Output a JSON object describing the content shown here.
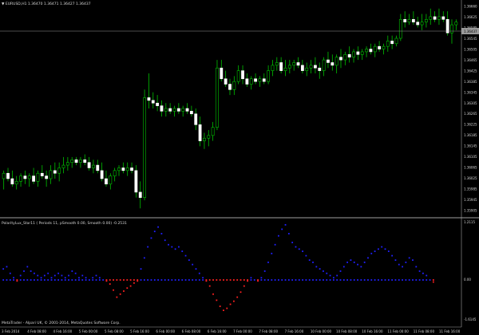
{
  "window": {
    "symbol_header": "▼ EURUSD,H1  1.36470 1.36471 1.36427 1.36437"
  },
  "colors": {
    "background": "#000000",
    "bull_candle": "#ffffff",
    "bear_candle": "#ffffff",
    "wick": "#00c000",
    "grid_separator": "#808080",
    "ask_line": "#9a9a9a",
    "dot_positive": "#2020ff",
    "dot_negative": "#ff2020"
  },
  "indicator": {
    "header": "PolarityLux_Star11  ( Periods 11, pSmooth 0.00, Smooth 0.00)  -0.2531",
    "axis_labels": [
      "1.2115",
      "0.00",
      "-1.6145"
    ]
  },
  "footer": {
    "copyright": "MetaTrader - Alpari UK, © 2001-2014, MetaQuotes Software Corp."
  },
  "price_axis": {
    "labels": [
      "1.36660",
      "1.36625",
      "1.36585",
      "1.36545",
      "1.36505",
      "1.36465",
      "1.36425",
      "1.36385",
      "1.36345",
      "1.36305",
      "1.36265",
      "1.36225",
      "1.36185",
      "1.36145",
      "1.36105",
      "1.36065",
      "1.36025",
      "1.35985",
      "1.35945",
      "1.35905"
    ],
    "ask_label": "1.36437"
  },
  "time_axis": {
    "labels": [
      "3 Feb 2014",
      "4 Feb 08:00",
      "4 Feb 16:00",
      "5 Feb 00:00",
      "5 Feb 08:00",
      "5 Feb 16:00",
      "6 Feb 00:00",
      "6 Feb 08:00",
      "6 Feb 16:00",
      "7 Feb 00:00",
      "7 Feb 08:00",
      "7 Feb 16:00",
      "10 Feb 00:00",
      "10 Feb 08:00",
      "10 Feb 16:00",
      "11 Feb 00:00",
      "11 Feb 08:00",
      "11 Feb 16:00"
    ]
  },
  "chart_data": {
    "type": "candlestick",
    "price_range": [
      1.359,
      1.3668
    ],
    "candles": [
      {
        "o": 1.3603,
        "h": 1.3606,
        "l": 1.3599,
        "c": 1.3605
      },
      {
        "o": 1.3605,
        "h": 1.3607,
        "l": 1.3602,
        "c": 1.3603
      },
      {
        "o": 1.3603,
        "h": 1.3606,
        "l": 1.36,
        "c": 1.3601
      },
      {
        "o": 1.3601,
        "h": 1.3604,
        "l": 1.3599,
        "c": 1.3602
      },
      {
        "o": 1.3602,
        "h": 1.3605,
        "l": 1.36,
        "c": 1.3604
      },
      {
        "o": 1.3604,
        "h": 1.3606,
        "l": 1.3601,
        "c": 1.3603
      },
      {
        "o": 1.3603,
        "h": 1.3605,
        "l": 1.36,
        "c": 1.3604
      },
      {
        "o": 1.3604,
        "h": 1.3607,
        "l": 1.3601,
        "c": 1.3602
      },
      {
        "o": 1.3602,
        "h": 1.3606,
        "l": 1.36,
        "c": 1.3605
      },
      {
        "o": 1.3605,
        "h": 1.3608,
        "l": 1.3603,
        "c": 1.3604
      },
      {
        "o": 1.3604,
        "h": 1.3606,
        "l": 1.36,
        "c": 1.3603
      },
      {
        "o": 1.3603,
        "h": 1.3608,
        "l": 1.3601,
        "c": 1.3606
      },
      {
        "o": 1.3606,
        "h": 1.3609,
        "l": 1.3603,
        "c": 1.3605
      },
      {
        "o": 1.3605,
        "h": 1.3609,
        "l": 1.3602,
        "c": 1.3607
      },
      {
        "o": 1.3607,
        "h": 1.3611,
        "l": 1.3605,
        "c": 1.3608
      },
      {
        "o": 1.3608,
        "h": 1.3611,
        "l": 1.3606,
        "c": 1.3609
      },
      {
        "o": 1.3609,
        "h": 1.3611,
        "l": 1.3607,
        "c": 1.361
      },
      {
        "o": 1.361,
        "h": 1.3611,
        "l": 1.3608,
        "c": 1.3609
      },
      {
        "o": 1.3609,
        "h": 1.3611,
        "l": 1.3607,
        "c": 1.361
      },
      {
        "o": 1.361,
        "h": 1.3612,
        "l": 1.3608,
        "c": 1.3609
      },
      {
        "o": 1.3609,
        "h": 1.3611,
        "l": 1.3606,
        "c": 1.3607
      },
      {
        "o": 1.3607,
        "h": 1.361,
        "l": 1.3605,
        "c": 1.3608
      },
      {
        "o": 1.3608,
        "h": 1.361,
        "l": 1.3605,
        "c": 1.3606
      },
      {
        "o": 1.3606,
        "h": 1.3609,
        "l": 1.3602,
        "c": 1.3603
      },
      {
        "o": 1.3603,
        "h": 1.3606,
        "l": 1.36,
        "c": 1.3601
      },
      {
        "o": 1.3601,
        "h": 1.3605,
        "l": 1.3599,
        "c": 1.3604
      },
      {
        "o": 1.3604,
        "h": 1.3607,
        "l": 1.3602,
        "c": 1.3606
      },
      {
        "o": 1.3606,
        "h": 1.3608,
        "l": 1.3604,
        "c": 1.3607
      },
      {
        "o": 1.3607,
        "h": 1.3609,
        "l": 1.3605,
        "c": 1.3606
      },
      {
        "o": 1.3606,
        "h": 1.3609,
        "l": 1.3604,
        "c": 1.3607
      },
      {
        "o": 1.3607,
        "h": 1.3609,
        "l": 1.3605,
        "c": 1.3606
      },
      {
        "o": 1.3606,
        "h": 1.3608,
        "l": 1.3596,
        "c": 1.3598
      },
      {
        "o": 1.3598,
        "h": 1.3602,
        "l": 1.3592,
        "c": 1.3596
      },
      {
        "o": 1.3596,
        "h": 1.3636,
        "l": 1.3595,
        "c": 1.3633
      },
      {
        "o": 1.3633,
        "h": 1.3642,
        "l": 1.3629,
        "c": 1.3632
      },
      {
        "o": 1.3632,
        "h": 1.3635,
        "l": 1.3629,
        "c": 1.3631
      },
      {
        "o": 1.3631,
        "h": 1.3634,
        "l": 1.3628,
        "c": 1.363
      },
      {
        "o": 1.363,
        "h": 1.3632,
        "l": 1.3626,
        "c": 1.3628
      },
      {
        "o": 1.3628,
        "h": 1.3631,
        "l": 1.3626,
        "c": 1.3629
      },
      {
        "o": 1.3629,
        "h": 1.3631,
        "l": 1.3627,
        "c": 1.3628
      },
      {
        "o": 1.3628,
        "h": 1.363,
        "l": 1.3626,
        "c": 1.3629
      },
      {
        "o": 1.3629,
        "h": 1.3631,
        "l": 1.3627,
        "c": 1.3628
      },
      {
        "o": 1.3628,
        "h": 1.363,
        "l": 1.3626,
        "c": 1.3629
      },
      {
        "o": 1.3629,
        "h": 1.3631,
        "l": 1.3627,
        "c": 1.3628
      },
      {
        "o": 1.3628,
        "h": 1.363,
        "l": 1.3626,
        "c": 1.3627
      },
      {
        "o": 1.3627,
        "h": 1.3629,
        "l": 1.3621,
        "c": 1.3623
      },
      {
        "o": 1.3623,
        "h": 1.3626,
        "l": 1.3615,
        "c": 1.3617
      },
      {
        "o": 1.3617,
        "h": 1.362,
        "l": 1.3614,
        "c": 1.3618
      },
      {
        "o": 1.3618,
        "h": 1.3621,
        "l": 1.3615,
        "c": 1.3619
      },
      {
        "o": 1.3619,
        "h": 1.3624,
        "l": 1.3617,
        "c": 1.3622
      },
      {
        "o": 1.3622,
        "h": 1.3647,
        "l": 1.3621,
        "c": 1.3644
      },
      {
        "o": 1.3644,
        "h": 1.3647,
        "l": 1.3639,
        "c": 1.364
      },
      {
        "o": 1.364,
        "h": 1.3643,
        "l": 1.3637,
        "c": 1.3638
      },
      {
        "o": 1.3638,
        "h": 1.364,
        "l": 1.3634,
        "c": 1.3636
      },
      {
        "o": 1.3636,
        "h": 1.3641,
        "l": 1.3634,
        "c": 1.3639
      },
      {
        "o": 1.3639,
        "h": 1.3645,
        "l": 1.3638,
        "c": 1.3643
      },
      {
        "o": 1.3643,
        "h": 1.3645,
        "l": 1.3638,
        "c": 1.364
      },
      {
        "o": 1.364,
        "h": 1.3642,
        "l": 1.3637,
        "c": 1.3638
      },
      {
        "o": 1.3638,
        "h": 1.3641,
        "l": 1.3636,
        "c": 1.364
      },
      {
        "o": 1.364,
        "h": 1.3642,
        "l": 1.3638,
        "c": 1.3639
      },
      {
        "o": 1.3639,
        "h": 1.3641,
        "l": 1.3637,
        "c": 1.364
      },
      {
        "o": 1.364,
        "h": 1.3642,
        "l": 1.3638,
        "c": 1.3639
      },
      {
        "o": 1.3639,
        "h": 1.3645,
        "l": 1.3638,
        "c": 1.3643
      },
      {
        "o": 1.3643,
        "h": 1.3647,
        "l": 1.3641,
        "c": 1.3645
      },
      {
        "o": 1.3645,
        "h": 1.3648,
        "l": 1.3643,
        "c": 1.3646
      },
      {
        "o": 1.3646,
        "h": 1.3648,
        "l": 1.3642,
        "c": 1.3643
      },
      {
        "o": 1.3643,
        "h": 1.3647,
        "l": 1.3641,
        "c": 1.3644
      },
      {
        "o": 1.3644,
        "h": 1.3647,
        "l": 1.3642,
        "c": 1.3645
      },
      {
        "o": 1.3645,
        "h": 1.3647,
        "l": 1.3643,
        "c": 1.3646
      },
      {
        "o": 1.3646,
        "h": 1.3648,
        "l": 1.3644,
        "c": 1.3645
      },
      {
        "o": 1.3645,
        "h": 1.3647,
        "l": 1.3642,
        "c": 1.3643
      },
      {
        "o": 1.3643,
        "h": 1.3646,
        "l": 1.3641,
        "c": 1.3644
      },
      {
        "o": 1.3644,
        "h": 1.3647,
        "l": 1.3642,
        "c": 1.3645
      },
      {
        "o": 1.3645,
        "h": 1.3648,
        "l": 1.3642,
        "c": 1.3644
      },
      {
        "o": 1.3644,
        "h": 1.3646,
        "l": 1.364,
        "c": 1.3643
      },
      {
        "o": 1.3643,
        "h": 1.3648,
        "l": 1.3641,
        "c": 1.3647
      },
      {
        "o": 1.3647,
        "h": 1.365,
        "l": 1.3644,
        "c": 1.3646
      },
      {
        "o": 1.3646,
        "h": 1.3649,
        "l": 1.3643,
        "c": 1.3645
      },
      {
        "o": 1.3645,
        "h": 1.3649,
        "l": 1.3642,
        "c": 1.3648
      },
      {
        "o": 1.3648,
        "h": 1.3651,
        "l": 1.3644,
        "c": 1.3647
      },
      {
        "o": 1.3647,
        "h": 1.365,
        "l": 1.3645,
        "c": 1.3649
      },
      {
        "o": 1.3649,
        "h": 1.3652,
        "l": 1.3646,
        "c": 1.3648
      },
      {
        "o": 1.3648,
        "h": 1.3651,
        "l": 1.3646,
        "c": 1.365
      },
      {
        "o": 1.365,
        "h": 1.3652,
        "l": 1.3647,
        "c": 1.3649
      },
      {
        "o": 1.3649,
        "h": 1.3651,
        "l": 1.3647,
        "c": 1.365
      },
      {
        "o": 1.365,
        "h": 1.3652,
        "l": 1.3648,
        "c": 1.3651
      },
      {
        "o": 1.3651,
        "h": 1.3653,
        "l": 1.3649,
        "c": 1.365
      },
      {
        "o": 1.365,
        "h": 1.3653,
        "l": 1.3648,
        "c": 1.3652
      },
      {
        "o": 1.3652,
        "h": 1.3654,
        "l": 1.365,
        "c": 1.3651
      },
      {
        "o": 1.3651,
        "h": 1.3653,
        "l": 1.3649,
        "c": 1.3652
      },
      {
        "o": 1.3652,
        "h": 1.3656,
        "l": 1.365,
        "c": 1.3654
      },
      {
        "o": 1.3654,
        "h": 1.3656,
        "l": 1.3651,
        "c": 1.3653
      },
      {
        "o": 1.3653,
        "h": 1.3656,
        "l": 1.3652,
        "c": 1.3655
      },
      {
        "o": 1.3655,
        "h": 1.3664,
        "l": 1.3654,
        "c": 1.3662
      },
      {
        "o": 1.3662,
        "h": 1.3665,
        "l": 1.3659,
        "c": 1.3661
      },
      {
        "o": 1.3661,
        "h": 1.3664,
        "l": 1.366,
        "c": 1.3662
      },
      {
        "o": 1.3662,
        "h": 1.3665,
        "l": 1.366,
        "c": 1.3661
      },
      {
        "o": 1.3661,
        "h": 1.3663,
        "l": 1.3659,
        "c": 1.366
      },
      {
        "o": 1.366,
        "h": 1.3664,
        "l": 1.3658,
        "c": 1.3661
      },
      {
        "o": 1.3661,
        "h": 1.3664,
        "l": 1.3659,
        "c": 1.3662
      },
      {
        "o": 1.3662,
        "h": 1.3666,
        "l": 1.366,
        "c": 1.3663
      },
      {
        "o": 1.3663,
        "h": 1.3665,
        "l": 1.3661,
        "c": 1.3662
      },
      {
        "o": 1.3662,
        "h": 1.3666,
        "l": 1.366,
        "c": 1.3663
      },
      {
        "o": 1.3663,
        "h": 1.3665,
        "l": 1.3661,
        "c": 1.3662
      },
      {
        "o": 1.3662,
        "h": 1.3665,
        "l": 1.3656,
        "c": 1.3657
      },
      {
        "o": 1.3657,
        "h": 1.3662,
        "l": 1.3653,
        "c": 1.366
      },
      {
        "o": 1.366,
        "h": 1.3662,
        "l": 1.3658,
        "c": 1.3661
      }
    ],
    "indicator_series": [
      0.25,
      0.3,
      0.15,
      0.05,
      -0.05,
      0.1,
      0.2,
      0.3,
      0.2,
      0.15,
      0.1,
      0.05,
      0.1,
      0.15,
      0.05,
      0.1,
      0.15,
      0.1,
      0.05,
      0.1,
      0.2,
      0.15,
      0.05,
      0.1,
      0.05,
      0.0,
      0.05,
      0.1,
      0.05,
      0.0,
      -0.05,
      -0.2,
      -0.5,
      -0.85,
      -0.7,
      -0.55,
      -0.4,
      -0.3,
      -0.15,
      -0.05,
      0.25,
      0.5,
      0.75,
      0.95,
      1.1,
      1.2,
      1.05,
      0.9,
      0.8,
      0.75,
      0.7,
      0.75,
      0.65,
      0.55,
      0.45,
      0.35,
      0.25,
      0.15,
      0.05,
      -0.05,
      -0.3,
      -0.7,
      -1.0,
      -1.3,
      -1.5,
      -1.4,
      -1.2,
      -1.05,
      -0.85,
      -0.6,
      -0.3,
      -0.05,
      0.05,
      0.0,
      -0.05,
      0.05,
      0.2,
      0.4,
      0.6,
      0.8,
      1.0,
      1.15,
      1.25,
      1.05,
      0.85,
      0.75,
      0.7,
      0.65,
      0.55,
      0.45,
      0.4,
      0.3,
      0.25,
      0.2,
      0.15,
      0.1,
      0.05,
      0.1,
      0.2,
      0.3,
      0.4,
      0.45,
      0.4,
      0.35,
      0.3,
      0.4,
      0.5,
      0.6,
      0.65,
      0.7,
      0.75,
      0.7,
      0.65,
      0.55,
      0.45,
      0.35,
      0.3,
      0.4,
      0.5,
      0.45,
      0.3,
      0.2,
      0.15,
      0.1,
      0.0,
      -0.1
    ]
  }
}
